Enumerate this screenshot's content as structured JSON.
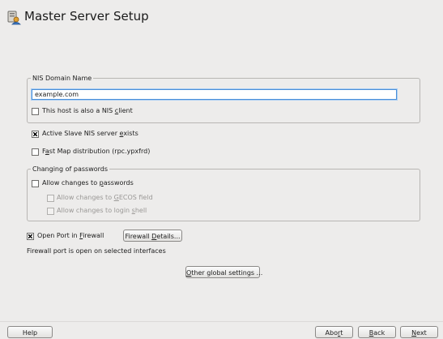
{
  "window": {
    "title": "Master Server Setup"
  },
  "nis_domain": {
    "legend": "NIS Domain Name",
    "value": "example.com",
    "nis_client_label": "This host is also a NIS client",
    "nis_client_checked": false
  },
  "options": {
    "slave_exists_label": "Active Slave NIS server exists",
    "slave_exists_checked": true,
    "fast_map_label": "Fast Map distribution (rpc.ypxfrd)",
    "fast_map_checked": false
  },
  "passwords": {
    "legend": "Changing of passwords",
    "allow_changes_label": "Allow changes to passwords",
    "allow_changes_checked": false,
    "gecos_label": "Allow changes to GECOS field",
    "shell_label": "Allow changes to login shell"
  },
  "firewall": {
    "open_port_label": "Open Port in Firewall",
    "open_port_checked": true,
    "details_button": "Firewall Details...",
    "status": "Firewall port is open on selected interfaces"
  },
  "other_settings_button": "Other global settings ...",
  "buttons": {
    "help": "Help",
    "abort": "Abort",
    "back": "Back",
    "next": "Next"
  }
}
